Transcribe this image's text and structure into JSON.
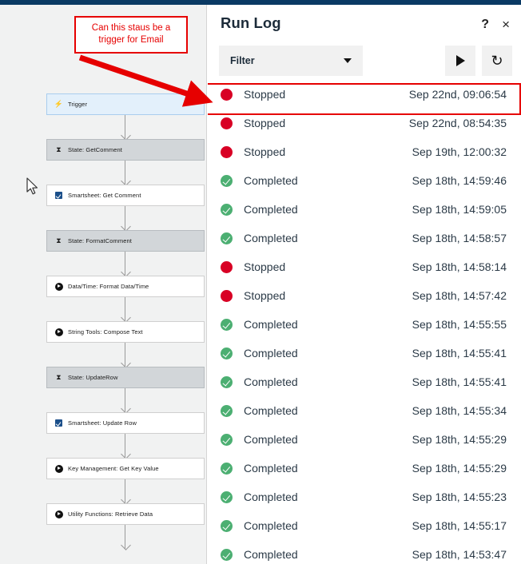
{
  "topbar": {
    "color": "#0a3a64"
  },
  "annotation": {
    "text": "Can this staus be a trigger for Email",
    "line1": "Can this staus be a",
    "line2": "trigger for Email",
    "border_color": "#e60000",
    "text_color": "#e60000",
    "arrow_color": "#e60000"
  },
  "flow": {
    "nodes": [
      {
        "label": "Trigger",
        "type": "trigger",
        "icon": "bolt-icon"
      },
      {
        "label": "State: GetComment",
        "type": "state",
        "icon": "hourglass-icon"
      },
      {
        "label": "Smartsheet: Get Comment",
        "type": "action",
        "icon": "smartsheet-icon"
      },
      {
        "label": "State: FormatComment",
        "type": "state",
        "icon": "hourglass-icon"
      },
      {
        "label": "Data/Time: Format Data/Time",
        "type": "action",
        "icon": "play-circle-icon"
      },
      {
        "label": "String Tools: Compose Text",
        "type": "action",
        "icon": "play-circle-icon"
      },
      {
        "label": "State: UpdateRow",
        "type": "state",
        "icon": "hourglass-icon"
      },
      {
        "label": "Smartsheet: Update Row",
        "type": "action",
        "icon": "smartsheet-icon"
      },
      {
        "label": "Key Management: Get Key Value",
        "type": "action",
        "icon": "play-circle-icon"
      },
      {
        "label": "Utility Functions: Retrieve Data",
        "type": "action",
        "icon": "play-circle-icon"
      }
    ]
  },
  "run_log": {
    "title": "Run Log",
    "help_label": "?",
    "close_label": "×",
    "filter_label": "Filter",
    "run_button_label": "",
    "refresh_button_label": "↻",
    "entries": [
      {
        "status": "Stopped",
        "timestamp": "Sep 22nd, 09:06:54",
        "state": "stopped",
        "highlighted": true
      },
      {
        "status": "Stopped",
        "timestamp": "Sep 22nd, 08:54:35",
        "state": "stopped",
        "highlighted": false
      },
      {
        "status": "Stopped",
        "timestamp": "Sep 19th, 12:00:32",
        "state": "stopped",
        "highlighted": false
      },
      {
        "status": "Completed",
        "timestamp": "Sep 18th, 14:59:46",
        "state": "completed",
        "highlighted": false
      },
      {
        "status": "Completed",
        "timestamp": "Sep 18th, 14:59:05",
        "state": "completed",
        "highlighted": false
      },
      {
        "status": "Completed",
        "timestamp": "Sep 18th, 14:58:57",
        "state": "completed",
        "highlighted": false
      },
      {
        "status": "Stopped",
        "timestamp": "Sep 18th, 14:58:14",
        "state": "stopped",
        "highlighted": false
      },
      {
        "status": "Stopped",
        "timestamp": "Sep 18th, 14:57:42",
        "state": "stopped",
        "highlighted": false
      },
      {
        "status": "Completed",
        "timestamp": "Sep 18th, 14:55:55",
        "state": "completed",
        "highlighted": false
      },
      {
        "status": "Completed",
        "timestamp": "Sep 18th, 14:55:41",
        "state": "completed",
        "highlighted": false
      },
      {
        "status": "Completed",
        "timestamp": "Sep 18th, 14:55:41",
        "state": "completed",
        "highlighted": false
      },
      {
        "status": "Completed",
        "timestamp": "Sep 18th, 14:55:34",
        "state": "completed",
        "highlighted": false
      },
      {
        "status": "Completed",
        "timestamp": "Sep 18th, 14:55:29",
        "state": "completed",
        "highlighted": false
      },
      {
        "status": "Completed",
        "timestamp": "Sep 18th, 14:55:29",
        "state": "completed",
        "highlighted": false
      },
      {
        "status": "Completed",
        "timestamp": "Sep 18th, 14:55:23",
        "state": "completed",
        "highlighted": false
      },
      {
        "status": "Completed",
        "timestamp": "Sep 18th, 14:55:17",
        "state": "completed",
        "highlighted": false
      },
      {
        "status": "Completed",
        "timestamp": "Sep 18th, 14:53:47",
        "state": "completed",
        "highlighted": false
      }
    ],
    "colors": {
      "stopped": "#d80024",
      "completed": "#4caf72",
      "text": "#2b3a47"
    }
  }
}
